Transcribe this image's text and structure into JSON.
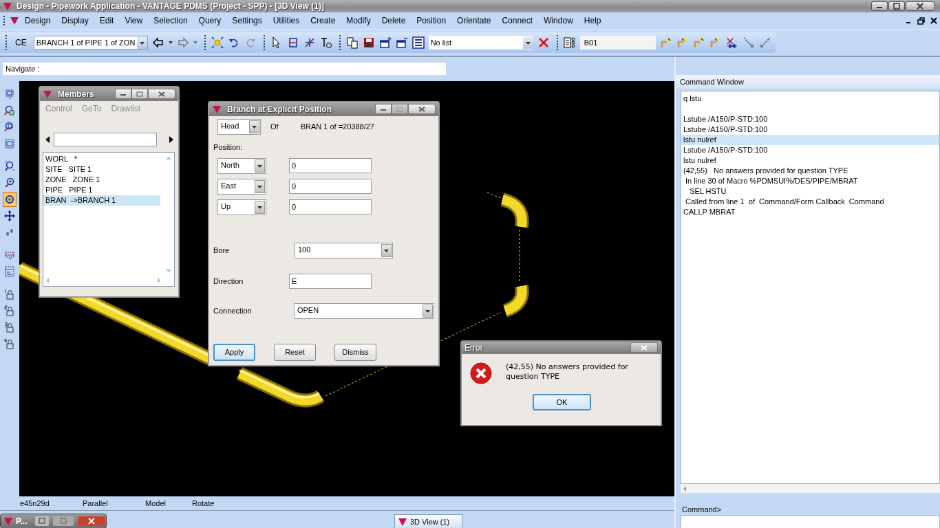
{
  "window": {
    "title": "Design - Pipework Application - VANTAGE PDMS (Project - SPP) - [3D View (1)]"
  },
  "menu": [
    "Design",
    "Display",
    "Edit",
    "View",
    "Selection",
    "Query",
    "Settings",
    "Utilities",
    "Create",
    "Modify",
    "Delete",
    "Position",
    "Orientate",
    "Connect",
    "Window",
    "Help"
  ],
  "toolbar": {
    "ce_label": "CE",
    "ce_value": "BRANCH 1 of PIPE 1 of ZON",
    "list_value": "No list",
    "name_value": "B01"
  },
  "navigate": {
    "label": "Navigate :"
  },
  "view_tools": [
    {
      "selected": false
    },
    {
      "selected": false
    },
    {
      "selected": false
    },
    {
      "selected": false
    },
    {
      "selected": false
    },
    {
      "selected": false
    },
    {
      "selected": true
    },
    {
      "selected": false
    },
    {
      "selected": false
    },
    {
      "selected": false
    },
    {
      "selected": false
    },
    {
      "selected": false
    },
    {
      "selected": false
    },
    {
      "selected": false
    },
    {
      "selected": false
    }
  ],
  "members": {
    "title": "Members",
    "menu": [
      {
        "label": "Control",
        "disabled": true
      },
      {
        "label": "GoTo",
        "disabled": true
      },
      {
        "label": "Drawlist",
        "disabled": true
      }
    ],
    "items": [
      {
        "text": "WORL   *",
        "selected": false
      },
      {
        "text": "SITE   SITE 1",
        "selected": false
      },
      {
        "text": "ZONE   ZONE 1",
        "selected": false
      },
      {
        "text": "PIPE   PIPE 1",
        "selected": false
      },
      {
        "text": "BRAN  ->BRANCH 1",
        "selected": true
      }
    ]
  },
  "branch_dialog": {
    "title": "Branch at Explicit Position",
    "head": "Head",
    "of_label": "Of",
    "of_value": "BRAN 1 of =20388/27",
    "position_label": "Position:",
    "positions": [
      {
        "axis": "North",
        "value": "0"
      },
      {
        "axis": "East",
        "value": "0"
      },
      {
        "axis": "Up",
        "value": "0"
      }
    ],
    "bore_label": "Bore",
    "bore": "100",
    "direction_label": "Direction",
    "direction": "E",
    "connection_label": "Connection",
    "connection": "OPEN",
    "buttons": [
      {
        "label": "Apply",
        "focused": true
      },
      {
        "label": "Reset",
        "focused": false
      },
      {
        "label": "Dismiss",
        "focused": false
      }
    ]
  },
  "error_dialog": {
    "title": "Error",
    "message": "(42,55) No answers provided for question TYPE",
    "button": "OK"
  },
  "command_window": {
    "title": "Command Window",
    "lines": [
      {
        "text": "q lstu",
        "selected": false
      },
      {
        "text": "Lstube /A150/P-STD:100",
        "selected": false
      },
      {
        "text": "Lstube /A150/P-STD:100",
        "selected": false
      },
      {
        "text": "lstu nulref",
        "selected": true
      },
      {
        "text": "Lstube /A150/P-STD:100",
        "selected": false
      },
      {
        "text": "lstu nulref",
        "selected": false
      },
      {
        "text": "(42,55)   No answers provided for question TYPE",
        "selected": false
      },
      {
        "text": " In line 30 of Macro %PDMSUI%/DES/PIPE/MBRAT",
        "selected": false
      },
      {
        "text": "   SEL HSTU",
        "selected": false
      },
      {
        "text": " Called from line 1  of  Command/Form Callback  Command",
        "selected": false
      },
      {
        "text": "CALLP MBRAT",
        "selected": false
      }
    ],
    "prompt": "Command>"
  },
  "status_bar": [
    "e45n29d",
    "Parallel",
    "Model",
    "Rotate"
  ],
  "taskbar": [
    {
      "label": "P...",
      "selected": false,
      "kind": "minimized"
    },
    {
      "label": "3D View (1)",
      "selected": true,
      "kind": "tab"
    }
  ]
}
